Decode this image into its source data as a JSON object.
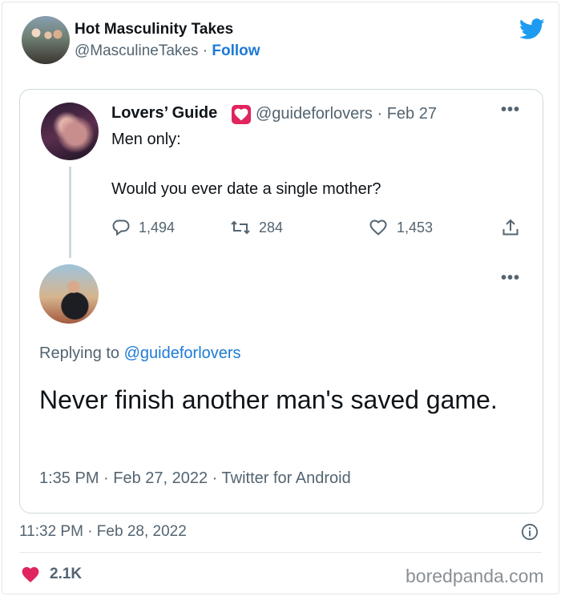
{
  "header": {
    "display_name": "Hot Masculinity Takes",
    "handle": "@MasculineTakes",
    "separator": " · ",
    "follow_label": "Follow"
  },
  "quoted_tweet": {
    "display_name": "Lovers’ Guide",
    "handle_date": "@guideforlovers · Feb 27",
    "line1": "Men only:",
    "line2": "Would you ever date a single mother?",
    "reply_count": "1,494",
    "retweet_count": "284",
    "like_count": "1,453",
    "more_label": "•••"
  },
  "reply_tweet": {
    "replying_prefix": "Replying to ",
    "replying_handle": "@guideforlovers",
    "text": "Never finish another man's saved game.",
    "meta": "1:35 PM · Feb 27, 2022 · Twitter for Android",
    "more_label": "•••"
  },
  "footer": {
    "timestamp": "11:32 PM · Feb 28, 2022",
    "likes": "2.1K",
    "watermark": "boredpanda.com"
  },
  "colors": {
    "link": "#1d7ad6",
    "heart": "#e0245e",
    "muted": "#536471",
    "twitter_blue": "#1d9bf0"
  }
}
